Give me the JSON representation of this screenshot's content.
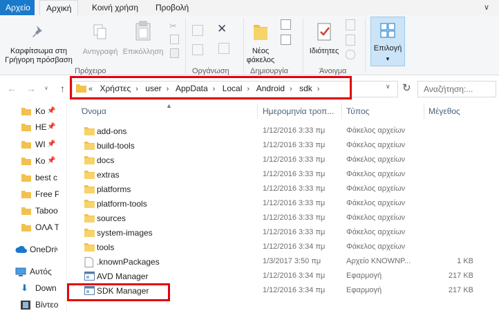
{
  "ribbon_tabs": {
    "file": "Αρχείο",
    "home": "Αρχική",
    "share": "Κοινή χρήση",
    "view": "Προβολή"
  },
  "ribbon": {
    "pin_quick_access": "Καρφίτσωμα στη Γρήγορη πρόσβαση",
    "copy": "Αντιγραφή",
    "paste": "Επικόλληση",
    "clipboard_group": "Πρόχειρο",
    "organize_group": "Οργάνωση",
    "new_folder": "Νέος φάκελος",
    "new_group": "Δημιουργία",
    "properties": "Ιδιότητες",
    "open_group": "Άνοιγμα",
    "select": "Επιλογή"
  },
  "address": {
    "prefix": "«",
    "crumbs": [
      "Χρήστες",
      "user",
      "AppData",
      "Local",
      "Android",
      "sdk"
    ],
    "search_placeholder": "Αναζήτηση:..."
  },
  "nav_pane": {
    "quick_items": [
      "Κο",
      "ΗΕ",
      "WI",
      "Κο",
      "best c",
      "Free P",
      "Taboo",
      "ΟΛΑ Τ"
    ],
    "onedrive": "OneDrive",
    "this_pc": "Αυτός",
    "downloads": "Down",
    "videos": "Βίντεο"
  },
  "columns": {
    "name": "Όνομα",
    "date": "Ημερομηνία τροπ...",
    "type": "Τύπος",
    "size": "Μέγεθος"
  },
  "files": [
    {
      "name": "add-ons",
      "date": "1/12/2016 3:33 πμ",
      "type": "Φάκελος αρχείων",
      "size": "",
      "icon": "folder-icon"
    },
    {
      "name": "build-tools",
      "date": "1/12/2016 3:33 πμ",
      "type": "Φάκελος αρχείων",
      "size": "",
      "icon": "folder-icon"
    },
    {
      "name": "docs",
      "date": "1/12/2016 3:33 πμ",
      "type": "Φάκελος αρχείων",
      "size": "",
      "icon": "folder-icon"
    },
    {
      "name": "extras",
      "date": "1/12/2016 3:33 πμ",
      "type": "Φάκελος αρχείων",
      "size": "",
      "icon": "folder-icon"
    },
    {
      "name": "platforms",
      "date": "1/12/2016 3:33 πμ",
      "type": "Φάκελος αρχείων",
      "size": "",
      "icon": "folder-icon"
    },
    {
      "name": "platform-tools",
      "date": "1/12/2016 3:33 πμ",
      "type": "Φάκελος αρχείων",
      "size": "",
      "icon": "folder-icon"
    },
    {
      "name": "sources",
      "date": "1/12/2016 3:33 πμ",
      "type": "Φάκελος αρχείων",
      "size": "",
      "icon": "folder-icon"
    },
    {
      "name": "system-images",
      "date": "1/12/2016 3:33 πμ",
      "type": "Φάκελος αρχείων",
      "size": "",
      "icon": "folder-icon"
    },
    {
      "name": "tools",
      "date": "1/12/2016 3:34 πμ",
      "type": "Φάκελος αρχείων",
      "size": "",
      "icon": "folder-icon"
    },
    {
      "name": ".knownPackages",
      "date": "1/3/2017 3:50 πμ",
      "type": "Αρχείο KNOWNP...",
      "size": "1 KB",
      "icon": "file-icon"
    },
    {
      "name": "AVD Manager",
      "date": "1/12/2016 3:34 πμ",
      "type": "Εφαρμογή",
      "size": "217 KB",
      "icon": "app-icon"
    },
    {
      "name": "SDK Manager",
      "date": "1/12/2016 3:34 πμ",
      "type": "Εφαρμογή",
      "size": "217 KB",
      "icon": "app-icon"
    }
  ],
  "colors": {
    "accent": "#1979ca",
    "folder": "#f2c14e",
    "highlight": "#e3000f"
  }
}
